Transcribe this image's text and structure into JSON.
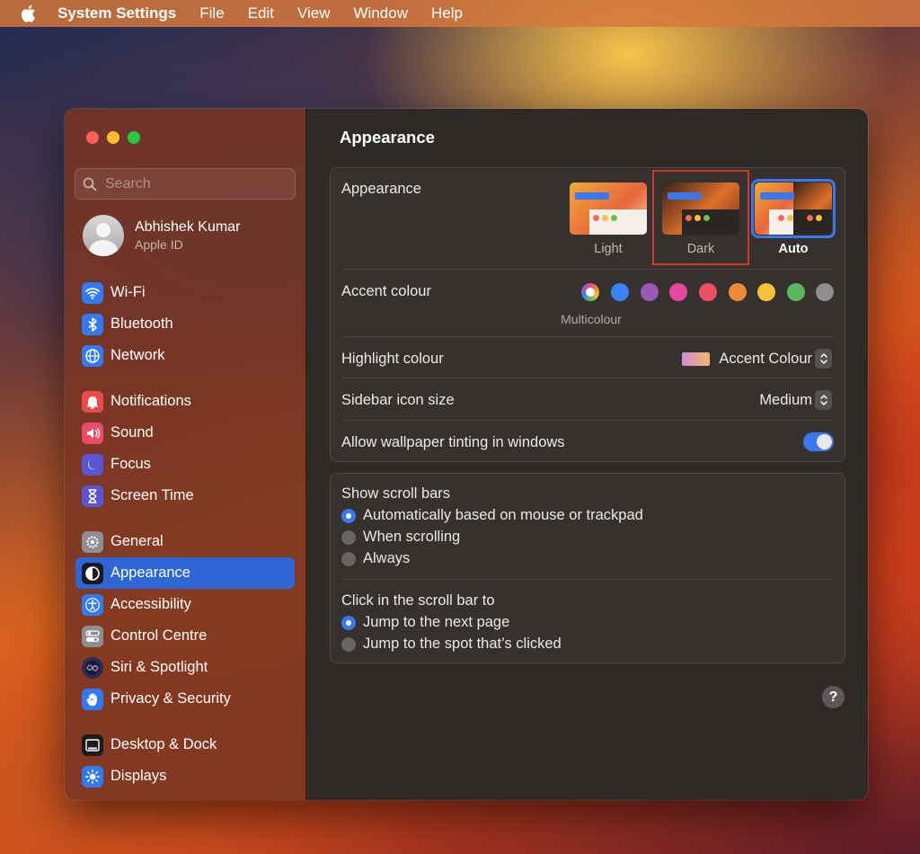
{
  "menubar": {
    "app_name": "System Settings",
    "items": [
      "File",
      "Edit",
      "View",
      "Window",
      "Help"
    ]
  },
  "sidebar": {
    "search_placeholder": "Search",
    "profile": {
      "name": "Abhishek Kumar",
      "subtitle": "Apple ID"
    },
    "groups": [
      [
        {
          "label": "Wi-Fi",
          "icon": "wifi-icon",
          "color": "#2f7bf5"
        },
        {
          "label": "Bluetooth",
          "icon": "bluetooth-icon",
          "color": "#2f7bf5"
        },
        {
          "label": "Network",
          "icon": "globe-icon",
          "color": "#2f7bf5"
        }
      ],
      [
        {
          "label": "Notifications",
          "icon": "bell-icon",
          "color": "#eb4b4b"
        },
        {
          "label": "Sound",
          "icon": "speaker-icon",
          "color": "#eb4b68"
        },
        {
          "label": "Focus",
          "icon": "moon-icon",
          "color": "#5b55d6"
        },
        {
          "label": "Screen Time",
          "icon": "hourglass-icon",
          "color": "#5b55d6"
        }
      ],
      [
        {
          "label": "General",
          "icon": "gear-icon",
          "color": "#8e8e93"
        },
        {
          "label": "Appearance",
          "icon": "appearance-icon",
          "color": "#1c1c1e",
          "active": true
        },
        {
          "label": "Accessibility",
          "icon": "accessibility-icon",
          "color": "#2f7bf5"
        },
        {
          "label": "Control Centre",
          "icon": "switches-icon",
          "color": "#8e8e93"
        },
        {
          "label": "Siri & Spotlight",
          "icon": "siri-icon",
          "color": "#2b2b55"
        },
        {
          "label": "Privacy & Security",
          "icon": "hand-icon",
          "color": "#2f7bf5"
        }
      ],
      [
        {
          "label": "Desktop & Dock",
          "icon": "dock-icon",
          "color": "#1c1c1e"
        },
        {
          "label": "Displays",
          "icon": "sun-icon",
          "color": "#2f7bf5"
        }
      ]
    ]
  },
  "main": {
    "title": "Appearance",
    "appearance": {
      "label": "Appearance",
      "options": [
        "Light",
        "Dark",
        "Auto"
      ],
      "selected": "Auto"
    },
    "accent": {
      "label": "Accent colour",
      "selected_caption": "Multicolour",
      "colors": [
        "multicolour",
        "#3b82f6",
        "#9b59b6",
        "#e5489a",
        "#ec5060",
        "#f08a33",
        "#f5c23a",
        "#5cb85c",
        "#8e8e8e"
      ]
    },
    "highlight": {
      "label": "Highlight colour",
      "value": "Accent Colour"
    },
    "sidebar_icon_size": {
      "label": "Sidebar icon size",
      "value": "Medium"
    },
    "wallpaper_tinting": {
      "label": "Allow wallpaper tinting in windows",
      "enabled": true
    },
    "scroll_bars": {
      "label": "Show scroll bars",
      "options": [
        "Automatically based on mouse or trackpad",
        "When scrolling",
        "Always"
      ],
      "selected": 0
    },
    "scroll_click": {
      "label": "Click in the scroll bar to",
      "options": [
        "Jump to the next page",
        "Jump to the spot that’s clicked"
      ],
      "selected": 0
    },
    "help_label": "?"
  }
}
